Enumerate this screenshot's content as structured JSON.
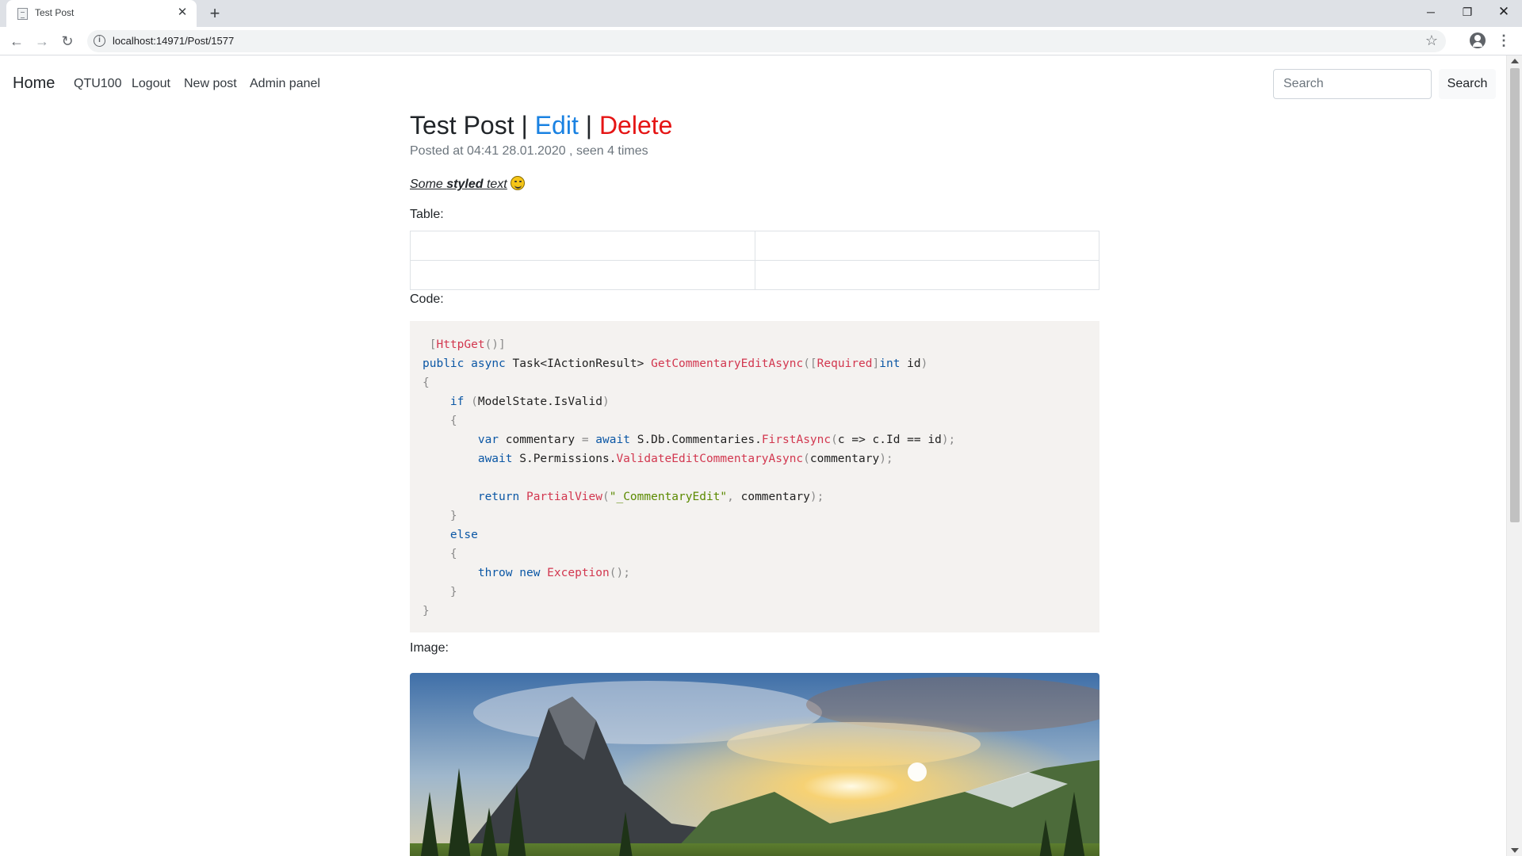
{
  "browser": {
    "tab_title": "Test Post",
    "url": "localhost:14971/Post/1577"
  },
  "site_nav": {
    "brand": "Home",
    "links": [
      "QTU100",
      "Logout",
      "New post",
      "Admin panel"
    ],
    "search_placeholder": "Search",
    "search_button": "Search"
  },
  "post": {
    "title": "Test Post",
    "separator": "|",
    "edit_label": "Edit",
    "delete_label": "Delete",
    "meta": "Posted at 04:41 28.01.2020 , seen 4 times",
    "styled_some": "Some",
    "styled_bold": "styled",
    "styled_text": "text",
    "table_label": "Table:",
    "table_rows": [
      [
        "",
        ""
      ],
      [
        "",
        ""
      ]
    ],
    "code_label": "Code:",
    "image_label": "Image:"
  },
  "code": {
    "line1_attr": "HttpGet",
    "line2_public": "public",
    "line2_async": "async",
    "line2_type": "Task<IActionResult>",
    "line2_method": "GetCommentaryEditAsync",
    "line2_required": "Required",
    "line2_int": "int",
    "line2_id": "id",
    "line4_if": "if",
    "line4_cond": "ModelState.IsValid",
    "line6_var": "var",
    "line6_name": "commentary",
    "line6_await": "await",
    "line6_obj": "S.Db.Commentaries.",
    "line6_method": "FirstAsync",
    "line6_lambda": "c => c.Id == id",
    "line7_await": "await",
    "line7_obj": "S.Permissions.",
    "line7_method": "ValidateEditCommentaryAsync",
    "line7_arg": "commentary",
    "line9_return": "return",
    "line9_method": "PartialView",
    "line9_string": "\"_CommentaryEdit\"",
    "line9_arg": "commentary",
    "line11_else": "else",
    "line13_throw": "throw",
    "line13_new": "new",
    "line13_exception": "Exception"
  },
  "colors": {
    "edit": "#1a82e2",
    "delete": "#e51515",
    "code_bg": "#f4f2f0",
    "keyword": "#0b57a5",
    "method": "#d2374f",
    "string": "#5b8a00"
  }
}
